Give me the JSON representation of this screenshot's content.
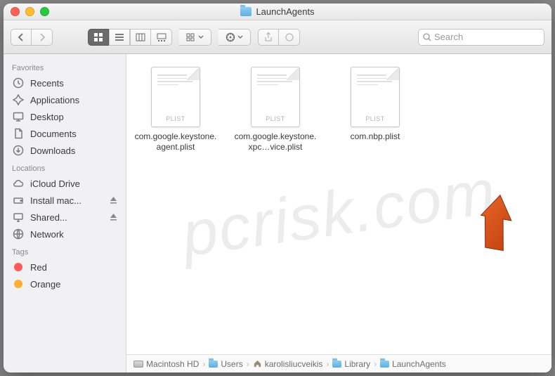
{
  "window": {
    "title": "LaunchAgents"
  },
  "toolbar": {
    "search_placeholder": "Search"
  },
  "sidebar": {
    "sections": [
      {
        "header": "Favorites",
        "items": [
          {
            "icon": "clock",
            "label": "Recents"
          },
          {
            "icon": "apps",
            "label": "Applications"
          },
          {
            "icon": "desktop",
            "label": "Desktop"
          },
          {
            "icon": "documents",
            "label": "Documents"
          },
          {
            "icon": "downloads",
            "label": "Downloads"
          }
        ]
      },
      {
        "header": "Locations",
        "items": [
          {
            "icon": "cloud",
            "label": "iCloud Drive"
          },
          {
            "icon": "disk",
            "label": "Install mac...",
            "eject": true
          },
          {
            "icon": "screen",
            "label": "Shared...",
            "eject": true
          },
          {
            "icon": "globe",
            "label": "Network"
          }
        ]
      },
      {
        "header": "Tags",
        "items": [
          {
            "icon": "tag",
            "tag_color": "#ff5b56",
            "label": "Red"
          },
          {
            "icon": "tag",
            "tag_color": "#ffae33",
            "label": "Orange"
          }
        ]
      }
    ]
  },
  "files": [
    {
      "type_label": "PLIST",
      "name": "com.google.keystone.agent.plist"
    },
    {
      "type_label": "PLIST",
      "name": "com.google.keystone.xpc…vice.plist"
    },
    {
      "type_label": "PLIST",
      "name": "com.nbp.plist"
    }
  ],
  "pathbar": [
    {
      "icon": "hd",
      "label": "Macintosh HD"
    },
    {
      "icon": "folder",
      "label": "Users"
    },
    {
      "icon": "home",
      "label": "karolisliucveikis"
    },
    {
      "icon": "folder",
      "label": "Library"
    },
    {
      "icon": "folder",
      "label": "LaunchAgents"
    }
  ],
  "watermark": "pcrisk.com",
  "annotation": {
    "arrow_color": "#d9541a"
  }
}
